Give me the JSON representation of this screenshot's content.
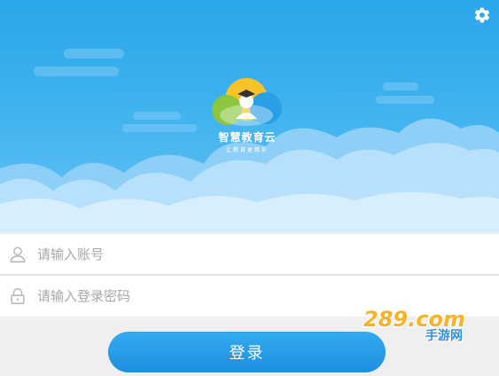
{
  "header": {
    "logo": {
      "title": "智慧教育云",
      "slogan": "让教育更精彩",
      "icon": "graduate-cloud-logo"
    },
    "settings_icon": "gear-icon"
  },
  "form": {
    "account": {
      "placeholder": "请输入账号",
      "value": "",
      "icon": "user-icon"
    },
    "password": {
      "placeholder": "请输入登录密码",
      "value": "",
      "icon": "lock-icon"
    },
    "login_label": "登录"
  },
  "watermark": {
    "site": "289.com",
    "text": "手游网"
  },
  "colors": {
    "header_top": "#2aa6ea",
    "header_bottom": "#63c3f4",
    "button": "#2a9fec",
    "watermark_orange": "#f7b22c",
    "watermark_blue": "#2e8fe6"
  }
}
